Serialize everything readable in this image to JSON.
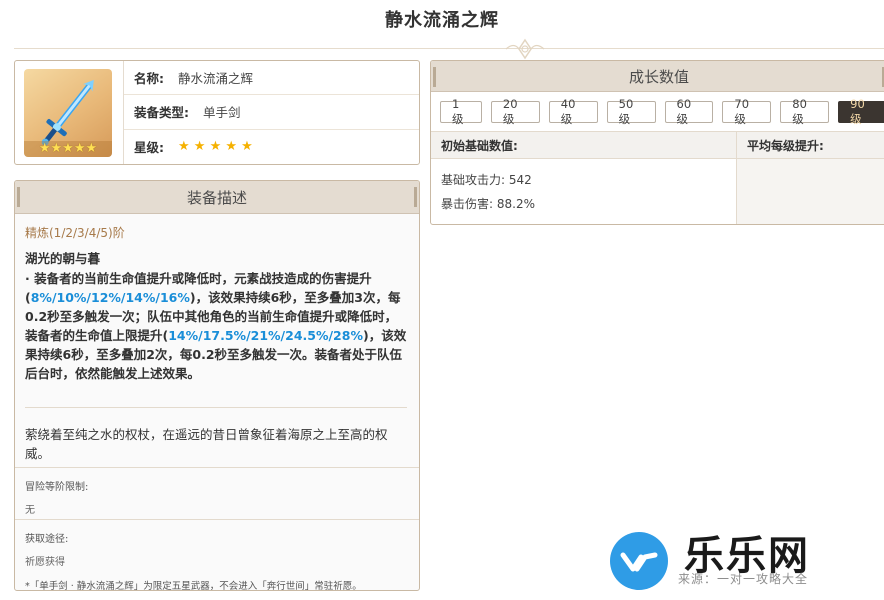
{
  "page": {
    "title": "静水流涌之辉"
  },
  "info": {
    "name_label": "名称:",
    "name_value": "静水流涌之辉",
    "type_label": "装备类型:",
    "type_value": "单手剑",
    "rarity_label": "星级:",
    "rarity_stars": 5,
    "thumb_stars": "★★★★★",
    "row_stars": "★ ★ ★ ★ ★"
  },
  "description": {
    "header": "装备描述",
    "refinement": "精炼(1/2/3/4/5)阶",
    "passive_name": "湖光的朝与暮",
    "passive_p1": "· 装备者的当前生命值提升或降低时，元素战技造成的伤害提升(",
    "passive_h1": "8%/10%/12%/14%/16%",
    "passive_p2": ")，该效果持续6秒，至多叠加3次，每0.2秒至多触发一次；队伍中其他角色的当前生命值提升或降低时，装备者的生命值上限提升(",
    "passive_h2": "14%/17.5%/21%/24.5%/28%",
    "passive_p3": ")，该效果持续6秒，至多叠加2次，每0.2秒至多触发一次。装备者处于队伍后台时，依然能触发上述效果。",
    "flavor": "萦绕着至纯之水的权杖，在遥远的昔日曾象征着海原之上至高的权威。",
    "ascension_label": "冒险等阶限制:",
    "ascension_value": "无",
    "source_label": "获取途径:",
    "source_value": "祈愿获得",
    "source_note": "*「单手剑 · 静水流涌之辉」为限定五星武器，不会进入「奔行世间」常驻祈愿。"
  },
  "growth": {
    "header": "成长数值",
    "levels": [
      "1级",
      "20级",
      "40级",
      "50级",
      "60级",
      "70级",
      "80级",
      "90级"
    ],
    "active_level": "90级",
    "col_initial": "初始基础数值:",
    "col_avg": "平均每级提升:",
    "stat_atk": "基础攻击力: 542",
    "stat_crit": "暴击伤害: 88.2%"
  },
  "watermark": {
    "brand": "乐乐网",
    "faint": "来源：一对一攻略大全"
  },
  "colors": {
    "accent_blue": "#1a8ed8",
    "star_gold": "#f5b100",
    "active_button": "#3b3530",
    "panel_header": "#e4dcd1",
    "refine_brown": "#a77a4a"
  }
}
